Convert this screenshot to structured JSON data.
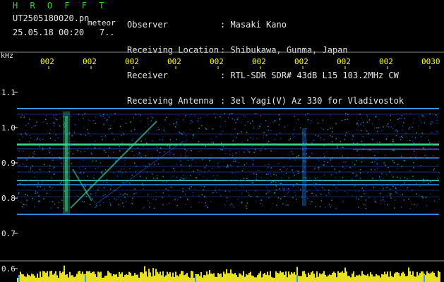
{
  "header": {
    "brand": "H R O F F T",
    "filename": "UT2505180020.pn",
    "mode": "meteor",
    "datetime": "25.05.18 00:20",
    "count": "7..",
    "info_labels": [
      "Observer",
      "Receiving Location",
      "Receiver",
      "Receiving Antenna"
    ],
    "info_values": [
      ": Masaki Kano",
      ": Shibukawa, Gunma, Japan",
      ": RTL-SDR SDR# 43dB L15 103.2MHz CW",
      ": 3el Yagi(V) Az 330 for Vladivostok"
    ]
  },
  "spectrogram": {
    "unit_label": "kHz",
    "y_ticks": [
      "1.1",
      "1.0",
      "0.9",
      "0.8",
      "0.7",
      "0.6"
    ],
    "time_ticks": [
      "002",
      "002",
      "002",
      "002",
      "002",
      "002",
      "002",
      "002",
      "002",
      "0030"
    ],
    "colors": {
      "text": "#e8e8e8",
      "tick": "#ffff00",
      "level": "#e8e020",
      "trace": "#2a5cff"
    }
  }
}
